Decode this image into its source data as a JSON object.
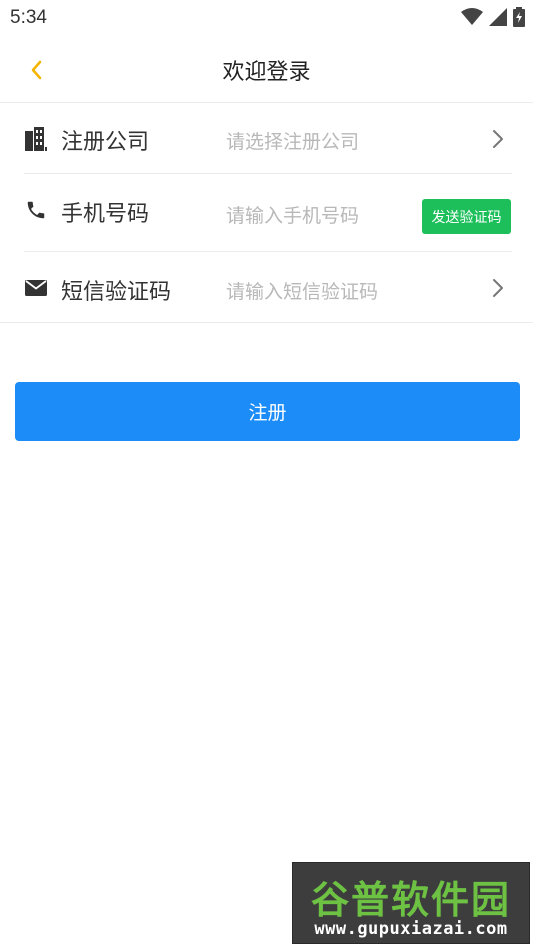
{
  "status_bar": {
    "time": "5:34",
    "icons": [
      "wifi-icon",
      "signal-icon",
      "battery-icon"
    ]
  },
  "nav": {
    "back_icon": "chevron-left-icon",
    "title": "欢迎登录"
  },
  "form": {
    "company": {
      "icon": "building-icon",
      "label": "注册公司",
      "placeholder": "请选择注册公司"
    },
    "phone": {
      "icon": "phone-icon",
      "label": "手机号码",
      "placeholder": "请输入手机号码",
      "send_code_label": "发送验证码"
    },
    "sms_code": {
      "icon": "mail-icon",
      "label": "短信验证码",
      "placeholder": "请输入短信验证码"
    }
  },
  "submit": {
    "label": "注册"
  },
  "watermark": {
    "brand": "谷普软件园",
    "url": "www.gupuxiazai.com"
  },
  "colors": {
    "accent": "#1b8cf8",
    "send_code": "#1dbf5b",
    "back_arrow": "#f5b400",
    "placeholder": "#b8b8b8"
  }
}
